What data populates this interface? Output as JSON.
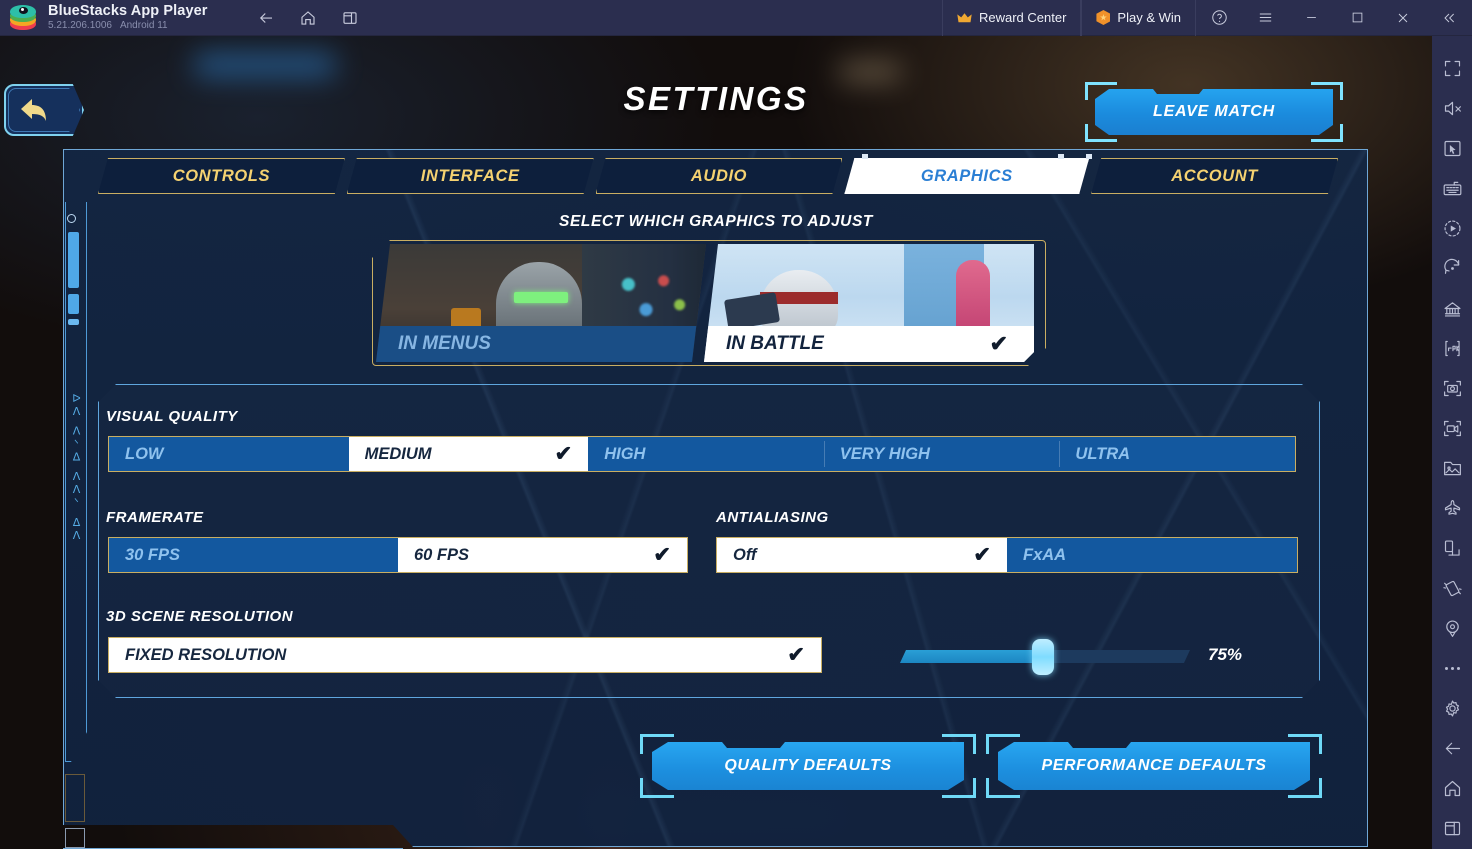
{
  "titlebar": {
    "app_name": "BlueStacks App Player",
    "version": "5.21.206.1006",
    "android": "Android 11",
    "nav": [
      {
        "name": "back-icon",
        "label": "Back"
      },
      {
        "name": "home-icon",
        "label": "Home"
      },
      {
        "name": "recents-icon",
        "label": "Recent apps"
      }
    ],
    "reward_center": "Reward Center",
    "play_and_win": "Play & Win",
    "help": "?",
    "menu": "Menu",
    "minimize": "Minimize",
    "maximize": "Maximize",
    "close": "Close",
    "collapse": "Collapse"
  },
  "rail": {
    "items": [
      {
        "name": "fullscreen-icon",
        "label": "Full screen"
      },
      {
        "name": "mute-icon",
        "label": "Mute"
      },
      {
        "name": "cursor-icon",
        "label": "Pointer"
      },
      {
        "name": "keymapping-icon",
        "label": "Game controls"
      },
      {
        "name": "macro-icon",
        "label": "Macro recorder"
      },
      {
        "name": "rotate-icon",
        "label": "Rotate"
      },
      {
        "name": "multi-instance-icon",
        "label": "Multi-instance manager"
      },
      {
        "name": "install-apk-icon",
        "label": "Install APK"
      },
      {
        "name": "screenshot-icon",
        "label": "Screenshot"
      },
      {
        "name": "screen-record-icon",
        "label": "Record screen"
      },
      {
        "name": "media-manager-icon",
        "label": "Media manager"
      },
      {
        "name": "eco-mode-icon",
        "label": "Eco mode"
      },
      {
        "name": "rotate-screen-icon",
        "label": "Rotate screen"
      },
      {
        "name": "shake-icon",
        "label": "Shake"
      },
      {
        "name": "location-icon",
        "label": "Location"
      },
      {
        "name": "more-icon",
        "label": "More"
      },
      {
        "name": "settings-gear-icon",
        "label": "Settings"
      },
      {
        "name": "android-back-icon",
        "label": "Back"
      },
      {
        "name": "android-home-icon",
        "label": "Home"
      },
      {
        "name": "android-recents-icon",
        "label": "Recent apps"
      }
    ]
  },
  "game": {
    "back_button": "Back",
    "title": "SETTINGS",
    "leave_match": "LEAVE MATCH",
    "left_strip_glyphs": "ᐅᐱ ᐱᐠᐃ ᐱᐱᐠ ᐃᐱ",
    "tabs": [
      {
        "label": "CONTROLS",
        "active": false
      },
      {
        "label": "INTERFACE",
        "active": false
      },
      {
        "label": "AUDIO",
        "active": false
      },
      {
        "label": "GRAPHICS",
        "active": true
      },
      {
        "label": "ACCOUNT",
        "active": false
      }
    ],
    "select_prompt": "SELECT WHICH GRAPHICS TO ADJUST",
    "scenes": [
      {
        "label": "IN MENUS",
        "selected": false
      },
      {
        "label": "IN BATTLE",
        "selected": true
      }
    ],
    "settings": {
      "visual_quality": {
        "label": "VISUAL QUALITY",
        "options": [
          "LOW",
          "MEDIUM",
          "HIGH",
          "VERY HIGH",
          "ULTRA"
        ],
        "selected": "MEDIUM"
      },
      "framerate": {
        "label": "FRAMERATE",
        "options": [
          "30 FPS",
          "60 FPS"
        ],
        "selected": "60 FPS"
      },
      "antialiasing": {
        "label": "ANTIALIASING",
        "options": [
          "Off",
          "FxAA"
        ],
        "selected": "Off"
      },
      "scene_resolution": {
        "label": "3D SCENE RESOLUTION",
        "options": [
          "FIXED RESOLUTION"
        ],
        "selected": "FIXED RESOLUTION",
        "slider_value": "75%",
        "slider_percent": 50
      }
    },
    "actions": [
      {
        "label": "QUALITY DEFAULTS"
      },
      {
        "label": "PERFORMANCE DEFAULTS"
      }
    ]
  },
  "colors": {
    "accent_blue": "#1d90e0",
    "gold": "#f5d271",
    "gold_border": "#c9ae62",
    "panel_blue": "#13263f",
    "segment_blue": "#13589f",
    "selected_white": "#ffffff",
    "titlebar": "#2b2e4f"
  }
}
